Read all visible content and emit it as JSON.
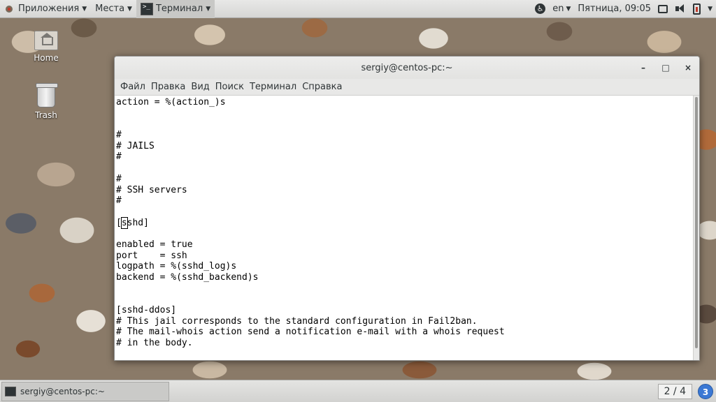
{
  "top_panel": {
    "applications": "Приложения",
    "places": "Места",
    "terminal": "Терминал",
    "language": "en",
    "clock": "Пятница, 09:05"
  },
  "desktop": {
    "home": "Home",
    "trash": "Trash"
  },
  "window": {
    "title": "sergiy@centos-pc:~",
    "minimize": "–",
    "maximize": "□",
    "close": "×",
    "menu": [
      "Файл",
      "Правка",
      "Вид",
      "Поиск",
      "Терминал",
      "Справка"
    ]
  },
  "terminal_lines": [
    "action = %(action_)s",
    "",
    "",
    "#",
    "# JAILS",
    "#",
    "",
    "#",
    "# SSH servers",
    "#",
    "",
    "[sshd]",
    "",
    "enabled = true",
    "port    = ssh",
    "logpath = %(sshd_log)s",
    "backend = %(sshd_backend)s",
    "",
    "",
    "[sshd-ddos]",
    "# This jail corresponds to the standard configuration in Fail2ban.",
    "# The mail-whois action send a notification e-mail with a whois request",
    "# in the body."
  ],
  "bottom_panel": {
    "task": "sergiy@centos-pc:~",
    "workspace": "2 / 4",
    "notifications": "3"
  }
}
